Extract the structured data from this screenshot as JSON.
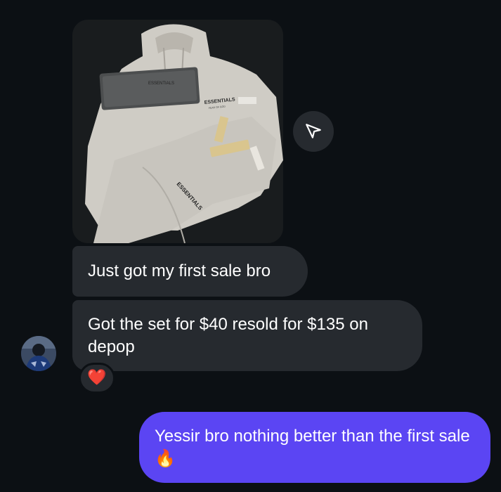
{
  "thread": {
    "shared_photo": {
      "alt": "Essentials hoodie and sweatpants laid out with tags"
    },
    "print": {
      "brand": "ESSENTIALS",
      "sub": "FEAR OF GOD"
    },
    "messages": [
      {
        "from": "them",
        "text": "Just got my first sale bro"
      },
      {
        "from": "them",
        "text": "Got the set for $40 resold for $135 on depop"
      },
      {
        "from": "me",
        "text": "Yessir bro nothing better than the first sale"
      }
    ],
    "reaction": {
      "emoji": "❤️"
    },
    "fire_emoji": "🔥"
  },
  "colors": {
    "background": "#0c1014",
    "incoming_bubble": "#262a2f",
    "outgoing_bubble": "#5b45f3",
    "text": "#ffffff"
  },
  "icons": {
    "share": "send-icon",
    "avatar": "avatar",
    "reaction": "heart-icon"
  }
}
